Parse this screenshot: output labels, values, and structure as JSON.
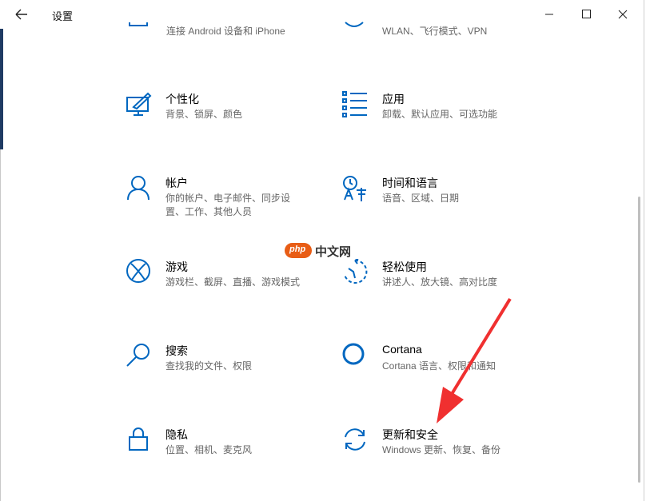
{
  "window": {
    "title": "设置"
  },
  "partial_row": [
    {
      "desc": "连接 Android 设备和 iPhone",
      "icon": "phone-icon"
    },
    {
      "desc": "WLAN、飞行模式、VPN",
      "icon": "globe-icon"
    }
  ],
  "items": [
    {
      "name": "个性化",
      "desc": "背景、锁屏、颜色",
      "icon": "personalization-icon"
    },
    {
      "name": "应用",
      "desc": "卸载、默认应用、可选功能",
      "icon": "apps-icon"
    },
    {
      "name": "帐户",
      "desc": "你的帐户、电子邮件、同步设置、工作、其他人员",
      "icon": "account-icon"
    },
    {
      "name": "时间和语言",
      "desc": "语音、区域、日期",
      "icon": "time-language-icon"
    },
    {
      "name": "游戏",
      "desc": "游戏栏、截屏、直播、游戏模式",
      "icon": "xbox-icon"
    },
    {
      "name": "轻松使用",
      "desc": "讲述人、放大镜、高对比度",
      "icon": "ease-of-access-icon"
    },
    {
      "name": "搜索",
      "desc": "查找我的文件、权限",
      "icon": "search-icon"
    },
    {
      "name": "Cortana",
      "desc": "Cortana 语言、权限和通知",
      "icon": "cortana-icon"
    },
    {
      "name": "隐私",
      "desc": "位置、相机、麦克风",
      "icon": "lock-icon"
    },
    {
      "name": "更新和安全",
      "desc": "Windows 更新、恢复、备份",
      "icon": "update-icon"
    }
  ],
  "watermark": {
    "badge": "php",
    "text": "中文网"
  },
  "colors": {
    "accent": "#0067c0",
    "annotation": "#f03030",
    "watermark_badge": "#e85d16"
  }
}
